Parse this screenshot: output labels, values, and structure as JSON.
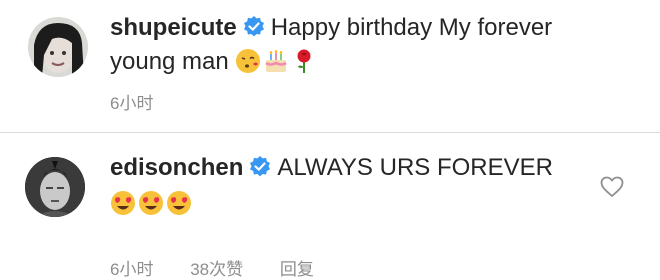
{
  "comments": [
    {
      "username": "shupeicute",
      "text_line1": "Happy birthday My forever",
      "text_line2": "young man",
      "emojis": [
        "kissing-face-emoji",
        "birthday-cake-emoji",
        "rose-emoji"
      ],
      "time": "6小时"
    },
    {
      "username": "edisonchen",
      "text_line1": "ALWAYS URS FOREVER",
      "emojis": [
        "heart-eyes-emoji",
        "heart-eyes-emoji",
        "heart-eyes-emoji"
      ],
      "time": "6小时",
      "likes": "38次赞",
      "reply": "回复"
    }
  ],
  "colors": {
    "verified_blue": "#3897f0",
    "meta_gray": "#8e8e8e",
    "text": "#262626"
  }
}
